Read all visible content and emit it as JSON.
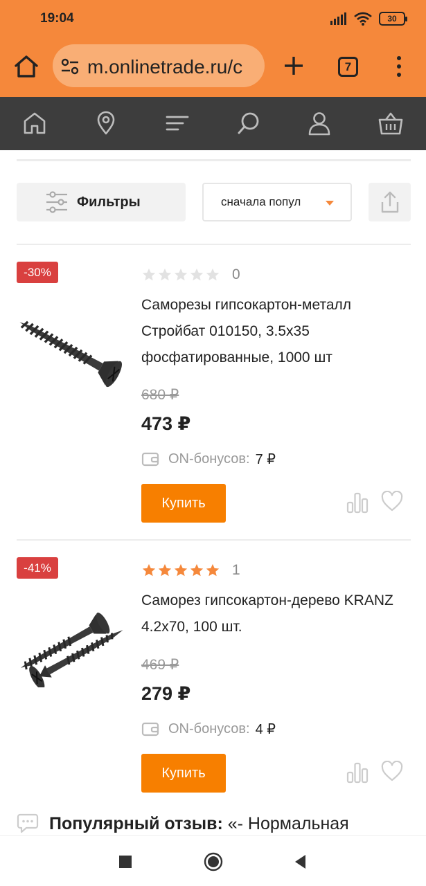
{
  "status_bar": {
    "time": "19:04",
    "battery": "30",
    "icons": [
      "signal-icon",
      "wifi-icon",
      "battery-icon"
    ]
  },
  "browser": {
    "url": "m.onlinetrade.ru/c",
    "tab_count": "7",
    "icons": [
      "home-icon",
      "site-settings-icon",
      "new-tab-icon",
      "tabs-icon",
      "more-menu-icon"
    ]
  },
  "site_nav": {
    "items": [
      "home-icon",
      "location-pin-icon",
      "catalog-menu-icon",
      "search-icon",
      "profile-icon",
      "cart-icon"
    ]
  },
  "toolbar": {
    "filters_label": "Фильтры",
    "sort_value": "сначала попул",
    "share_icon": "share-icon"
  },
  "products": [
    {
      "discount": "-30%",
      "rating": 0,
      "reviews": "0",
      "title": "Саморезы гипсокартон-металл Стройбат 010150, 3.5x35 фосфатированные, 1000 шт",
      "old_price": "680 ₽",
      "price": "473 ₽",
      "bonus_label": "ON-бонусов:",
      "bonus_value": "7 ₽",
      "buy_label": "Купить"
    },
    {
      "discount": "-41%",
      "rating": 5,
      "reviews": "1",
      "title": "Саморез гипсокартон-дерево KRANZ 4.2x70, 100 шт.",
      "old_price": "469 ₽",
      "price": "279 ₽",
      "bonus_label": "ON-бонусов:",
      "bonus_value": "4 ₽",
      "buy_label": "Купить"
    }
  ],
  "popular_review": {
    "label": "Популярный отзыв:",
    "text": " «- Нормальная"
  },
  "colors": {
    "brand_orange": "#f5883b",
    "buy_button": "#f77f00",
    "discount_badge": "#d9403f",
    "nav_dark": "#3d3d3d",
    "star_filled": "#f5883b",
    "star_empty": "#e2e2e2"
  }
}
